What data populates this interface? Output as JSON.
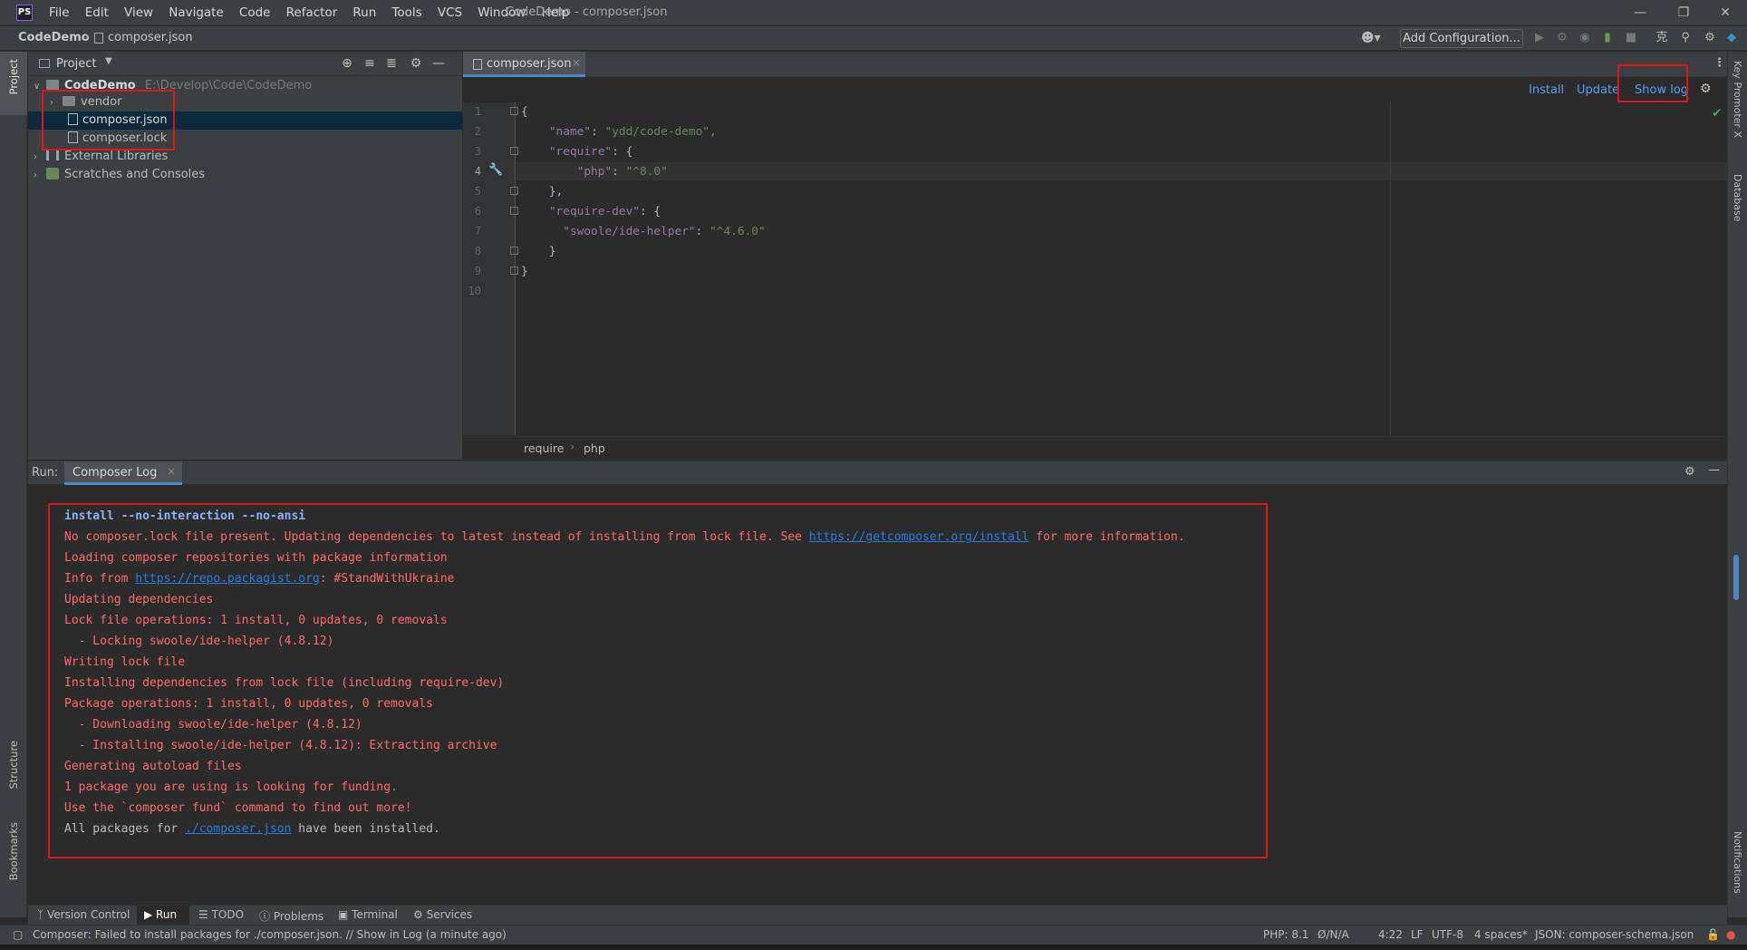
{
  "app": {
    "logo": "PS",
    "window_title": "CodeDemo - composer.json",
    "menu": [
      "File",
      "Edit",
      "View",
      "Navigate",
      "Code",
      "Refactor",
      "Run",
      "Tools",
      "VCS",
      "Window",
      "Help"
    ]
  },
  "navbar": {
    "project": "CodeDemo",
    "file": "composer.json",
    "add_configuration": "Add Configuration..."
  },
  "left_stripe": {
    "project": "Project",
    "structure": "Structure",
    "bookmarks": "Bookmarks"
  },
  "right_stripe": {
    "key_promoter": "Key Promoter X",
    "database": "Database",
    "notifications": "Notifications"
  },
  "project_panel": {
    "title": "Project",
    "tree": {
      "root_name": "CodeDemo",
      "root_path": "E:\\Develop\\Code\\CodeDemo",
      "vendor": "vendor",
      "composer_json": "composer.json",
      "composer_lock": "composer.lock",
      "external_libraries": "External Libraries",
      "scratches": "Scratches and Consoles"
    }
  },
  "editor": {
    "tab": "composer.json",
    "actions": {
      "install": "Install",
      "update": "Update",
      "show_log": "Show log"
    },
    "line_numbers": [
      "1",
      "2",
      "3",
      "4",
      "5",
      "6",
      "7",
      "8",
      "9",
      "10"
    ],
    "code": {
      "l1": "{",
      "l2_key": "\"name\"",
      "l2_val": "\"ydd/code-demo\"",
      "l3_key": "\"require\"",
      "l4_key": "\"php\"",
      "l4_val": "\"^8.0\"",
      "l5": "},",
      "l6_key": "\"require-dev\"",
      "l7_key": "\"swoole/ide-helper\"",
      "l7_val": "\"^4.6.0\"",
      "l8": "}",
      "l9": "}"
    },
    "breadcrumb": [
      "require",
      "php"
    ]
  },
  "run_panel": {
    "label": "Run:",
    "tab": "Composer Log",
    "console": {
      "cmd": "install --no-interaction --no-ansi",
      "l2_a": "No composer.lock file present. Updating dependencies to latest instead of installing from lock file. See ",
      "l2_link": "https://getcomposer.org/install",
      "l2_b": " for more information.",
      "l3": "Loading composer repositories with package information",
      "l4_a": "Info from ",
      "l4_link": "https://repo.packagist.org",
      "l4_b": ": #StandWithUkraine",
      "l5": "Updating dependencies",
      "l6": "Lock file operations: 1 install, 0 updates, 0 removals",
      "l7": "  - Locking swoole/ide-helper (4.8.12)",
      "l8": "Writing lock file",
      "l9": "Installing dependencies from lock file (including require-dev)",
      "l10": "Package operations: 1 install, 0 updates, 0 removals",
      "l11": "  - Downloading swoole/ide-helper (4.8.12)",
      "l12": "  - Installing swoole/ide-helper (4.8.12): Extracting archive",
      "l13": "Generating autoload files",
      "l14": "1 package you are using is looking for funding.",
      "l15": "Use the `composer fund` command to find out more!",
      "l16_a": "All packages for ",
      "l16_link": "./composer.json",
      "l16_b": " have been installed."
    }
  },
  "toolwindows": {
    "version_control": "Version Control",
    "run": "Run",
    "todo": "TODO",
    "problems": "Problems",
    "terminal": "Terminal",
    "services": "Services"
  },
  "statusbar": {
    "message": "Composer: Failed to install packages for  ./composer.json. // Show in Log (a minute ago)",
    "php": "PHP: 8.1",
    "na": "Ø/N/A",
    "position": "4:22",
    "line_sep": "LF",
    "encoding": "UTF-8",
    "indent": "4 spaces*",
    "schema": "JSON: composer-schema.json"
  },
  "colors": {
    "highlight_box": "#e0141b",
    "link": "#589df6",
    "error_text": "#ff6b68"
  }
}
